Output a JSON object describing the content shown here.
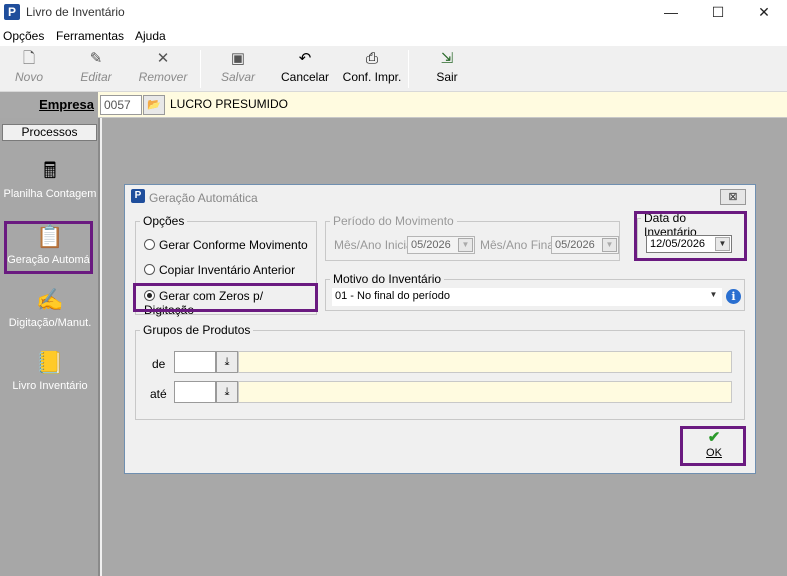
{
  "window": {
    "title": "Livro de Inventário",
    "minimize": "—",
    "maximize": "☐",
    "close": "✕"
  },
  "menu": [
    "Opções",
    "Ferramentas",
    "Ajuda"
  ],
  "toolbar": {
    "novo": {
      "label": "Novo",
      "icon": "new-document-icon",
      "enabled": false
    },
    "editar": {
      "label": "Editar",
      "icon": "edit-icon",
      "enabled": false
    },
    "remover": {
      "label": "Remover",
      "icon": "remove-icon",
      "enabled": false
    },
    "salvar": {
      "label": "Salvar",
      "icon": "save-icon",
      "enabled": false
    },
    "cancelar": {
      "label": "Cancelar",
      "icon": "undo-icon",
      "enabled": true
    },
    "conf_impr": {
      "label": "Conf. Impr.",
      "icon": "printer-icon",
      "enabled": true
    },
    "sair": {
      "label": "Sair",
      "icon": "exit-door-icon",
      "enabled": true
    }
  },
  "empresa": {
    "label": "Empresa",
    "code": "0057",
    "name": "LUCRO PRESUMIDO"
  },
  "sidebar": {
    "header": "Processos",
    "items": [
      {
        "label": "Planilha Contagem",
        "icon": "calculator-icon"
      },
      {
        "label": "Geração Automát",
        "icon": "auto-generate-icon",
        "highlighted": true
      },
      {
        "label": "Digitação/Manut.",
        "icon": "typing-icon"
      },
      {
        "label": "Livro Inventário",
        "icon": "book-icon"
      }
    ]
  },
  "dialog": {
    "title": "Geração Automática",
    "close": "⊠",
    "opcoes": {
      "legend": "Opções",
      "items": [
        {
          "label": "Gerar Conforme Movimento",
          "selected": false
        },
        {
          "label": "Copiar Inventário Anterior",
          "selected": false
        },
        {
          "label": "Gerar com Zeros p/ Digitação",
          "selected": true
        }
      ]
    },
    "periodo": {
      "legend": "Período do Movimento",
      "inicial_label": "Mês/Ano Inicial",
      "inicial_value": "05/2026",
      "final_label": "Mês/Ano Final",
      "final_value": "05/2026"
    },
    "data_inventario": {
      "legend": "Data do Inventário",
      "value": "12/05/2026"
    },
    "motivo": {
      "legend": "Motivo do Inventário",
      "value": "01 - No final do período"
    },
    "grupos": {
      "legend": "Grupos de Produtos",
      "de_label": "de",
      "ate_label": "até"
    },
    "ok_label": "OK"
  },
  "colors": {
    "highlight": "#6a1a80",
    "sidebar_bg": "#a7a7a7",
    "yellow_field": "#fffbe0"
  }
}
